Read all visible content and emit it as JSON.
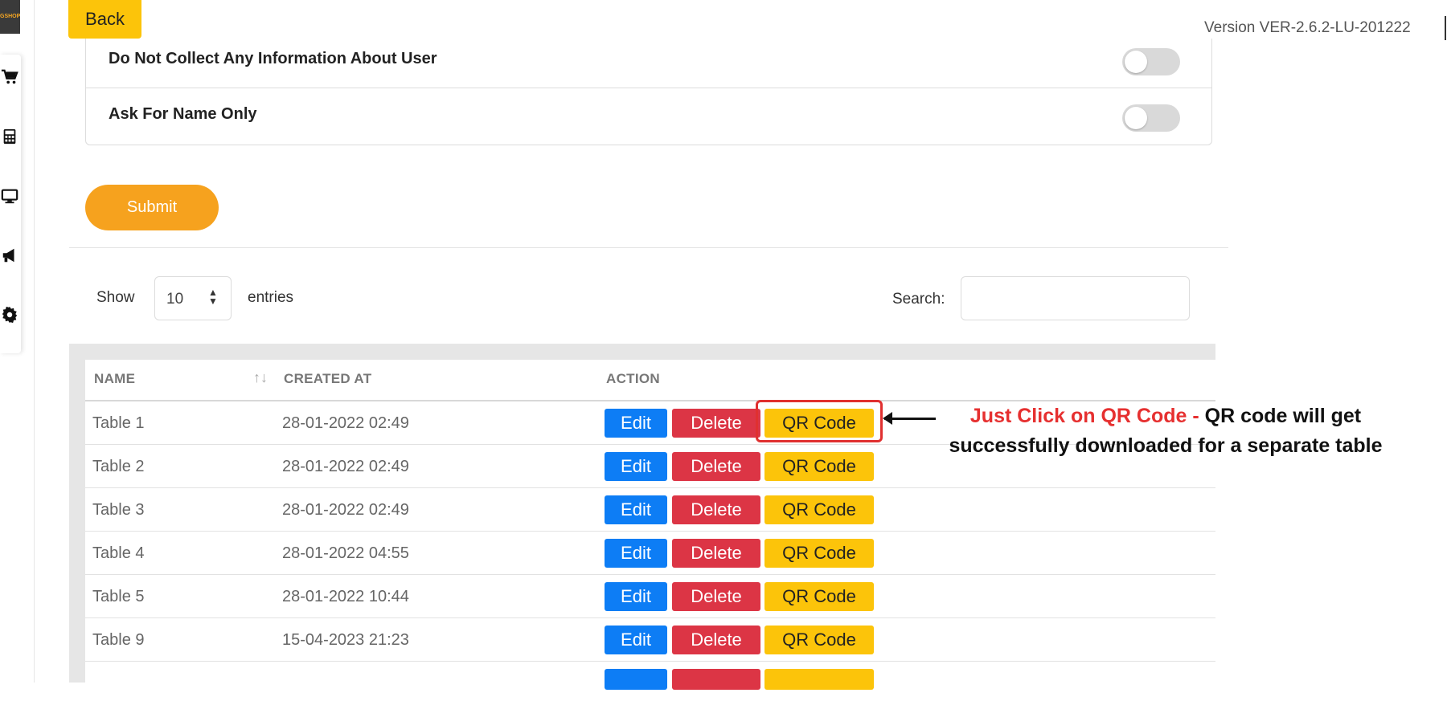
{
  "sidebar": {
    "logo_text": "GSHOP",
    "icons": [
      "cart-icon",
      "calculator-icon",
      "monitor-icon",
      "megaphone-icon",
      "gear-icon"
    ]
  },
  "header": {
    "back_label": "Back",
    "version": "Version VER-2.6.2-LU-201222"
  },
  "options": [
    {
      "label": "Do Not Collect Any Information About User",
      "enabled": false
    },
    {
      "label": "Ask For Name Only",
      "enabled": false
    }
  ],
  "submit_label": "Submit",
  "table_controls": {
    "show_label": "Show",
    "entries_value": "10",
    "entries_label": "entries",
    "search_label": "Search:",
    "search_value": ""
  },
  "table": {
    "columns": [
      "NAME",
      "CREATED AT",
      "ACTION"
    ],
    "rows": [
      {
        "name": "Table 1",
        "created_at": "28-01-2022 02:49"
      },
      {
        "name": "Table 2",
        "created_at": "28-01-2022 02:49"
      },
      {
        "name": "Table 3",
        "created_at": "28-01-2022 02:49"
      },
      {
        "name": "Table 4",
        "created_at": "28-01-2022 04:55"
      },
      {
        "name": "Table 5",
        "created_at": "28-01-2022 10:44"
      },
      {
        "name": "Table 9",
        "created_at": "15-04-2023 21:23"
      }
    ],
    "actions": {
      "edit": "Edit",
      "delete": "Delete",
      "qr": "QR Code"
    }
  },
  "annotation": {
    "highlight": "Just Click on QR Code -",
    "text": " QR code will get successfully downloaded for a separate table"
  },
  "colors": {
    "accent_orange": "#f6a21e",
    "yellow": "#fcc40a",
    "blue": "#0d7df5",
    "red": "#dc3545"
  }
}
